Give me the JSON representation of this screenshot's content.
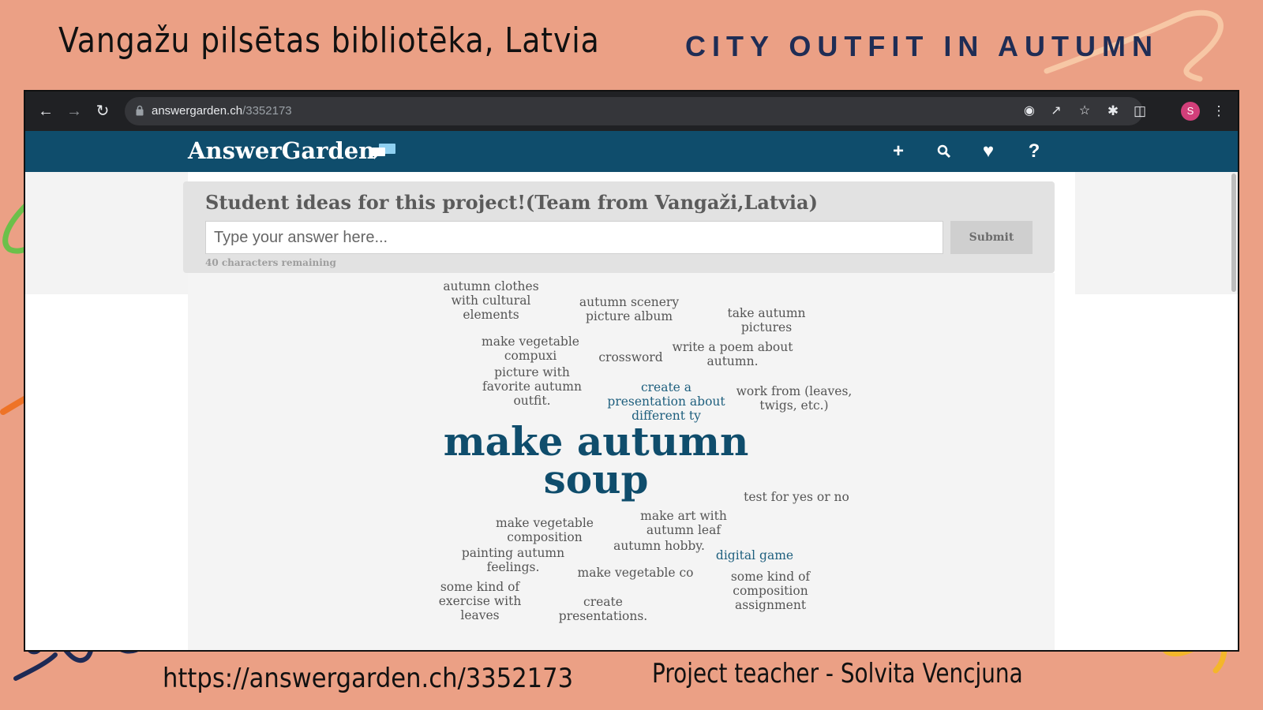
{
  "slide": {
    "title_left": "Vangažu pilsētas bibliotēka, Latvia",
    "title_right": "CITY OUTFIT IN AUTUMN",
    "footer_url": "https://answergarden.ch/3352173",
    "footer_teacher": "Project teacher - Solvita Vencjuna"
  },
  "browser": {
    "url_host": "answergarden.ch",
    "url_path": "/3352173",
    "profile_initial": "S"
  },
  "site": {
    "logo": "AnswerGarden",
    "question": "Student ideas for this project!(Team from Vangaži,Latvia)",
    "input_placeholder": "Type your answer here...",
    "input_value": "",
    "submit_label": "Submit",
    "remaining": "40 characters remaining"
  },
  "answers": [
    {
      "text": "autumn clothes\nwith cultural\nelements",
      "size": "normal"
    },
    {
      "text": "autumn scenery\npicture album",
      "size": "normal"
    },
    {
      "text": "take autumn\npictures",
      "size": "normal"
    },
    {
      "text": "make vegetable\ncompuxi",
      "size": "normal"
    },
    {
      "text": "crossword",
      "size": "normal"
    },
    {
      "text": "write a poem about\nautumn.",
      "size": "normal"
    },
    {
      "text": "picture with\nfavorite autumn\noutfit.",
      "size": "normal"
    },
    {
      "text": "create a\npresentation about\ndifferent ty",
      "size": "highlight"
    },
    {
      "text": "work from (leaves,\ntwigs, etc.)",
      "size": "normal"
    },
    {
      "text": "make autumn\nsoup",
      "size": "big"
    },
    {
      "text": "test for yes or no",
      "size": "normal"
    },
    {
      "text": "make vegetable\ncomposition",
      "size": "normal"
    },
    {
      "text": "make art with\nautumn leaf",
      "size": "normal"
    },
    {
      "text": "autumn hobby.",
      "size": "normal"
    },
    {
      "text": "painting autumn\nfeelings.",
      "size": "normal"
    },
    {
      "text": "digital game",
      "size": "highlight"
    },
    {
      "text": "make vegetable co",
      "size": "normal"
    },
    {
      "text": "some kind of\ncomposition\nassignment",
      "size": "normal"
    },
    {
      "text": "some kind of\nexercise with\nleaves",
      "size": "normal"
    },
    {
      "text": "create\npresentations.",
      "size": "normal"
    }
  ]
}
